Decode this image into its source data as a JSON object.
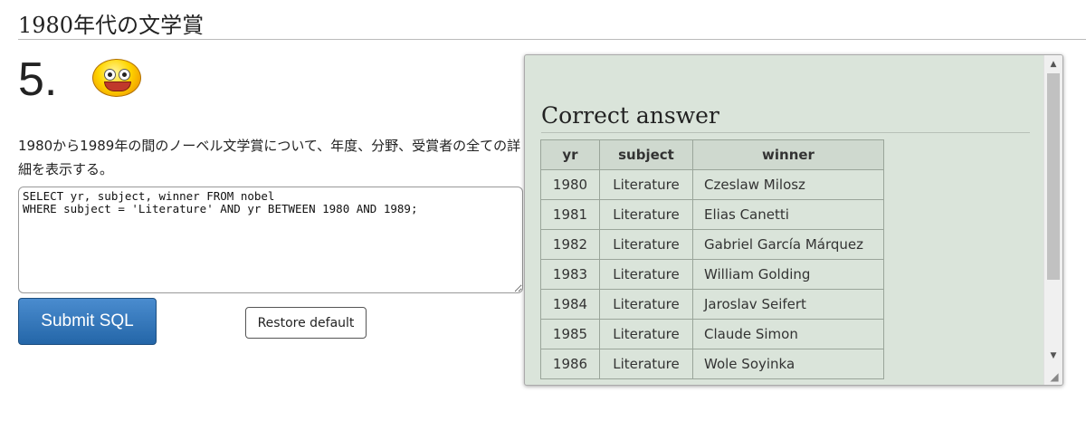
{
  "header": {
    "title": "1980年代の文学賞"
  },
  "question": {
    "number": "5.",
    "smiley_icon": "smiley-face-icon",
    "text": "1980から1989年の間のノーベル文学賞について、年度、分野、受賞者の全ての詳細を表示する。"
  },
  "editor": {
    "sql": "SELECT yr, subject, winner FROM nobel\nWHERE subject = 'Literature' AND yr BETWEEN 1980 AND 1989;"
  },
  "buttons": {
    "submit_label": "Submit SQL",
    "restore_label": "Restore default"
  },
  "answer": {
    "title": "Correct answer",
    "columns": [
      "yr",
      "subject",
      "winner"
    ],
    "rows": [
      [
        "1980",
        "Literature",
        "Czeslaw Milosz"
      ],
      [
        "1981",
        "Literature",
        "Elias Canetti"
      ],
      [
        "1982",
        "Literature",
        "Gabriel García Márquez"
      ],
      [
        "1983",
        "Literature",
        "William Golding"
      ],
      [
        "1984",
        "Literature",
        "Jaroslav Seifert"
      ],
      [
        "1985",
        "Literature",
        "Claude Simon"
      ],
      [
        "1986",
        "Literature",
        "Wole Soyinka"
      ]
    ]
  },
  "icons": {
    "scroll_up": "▲",
    "scroll_down": "▼",
    "resize": "◢"
  }
}
